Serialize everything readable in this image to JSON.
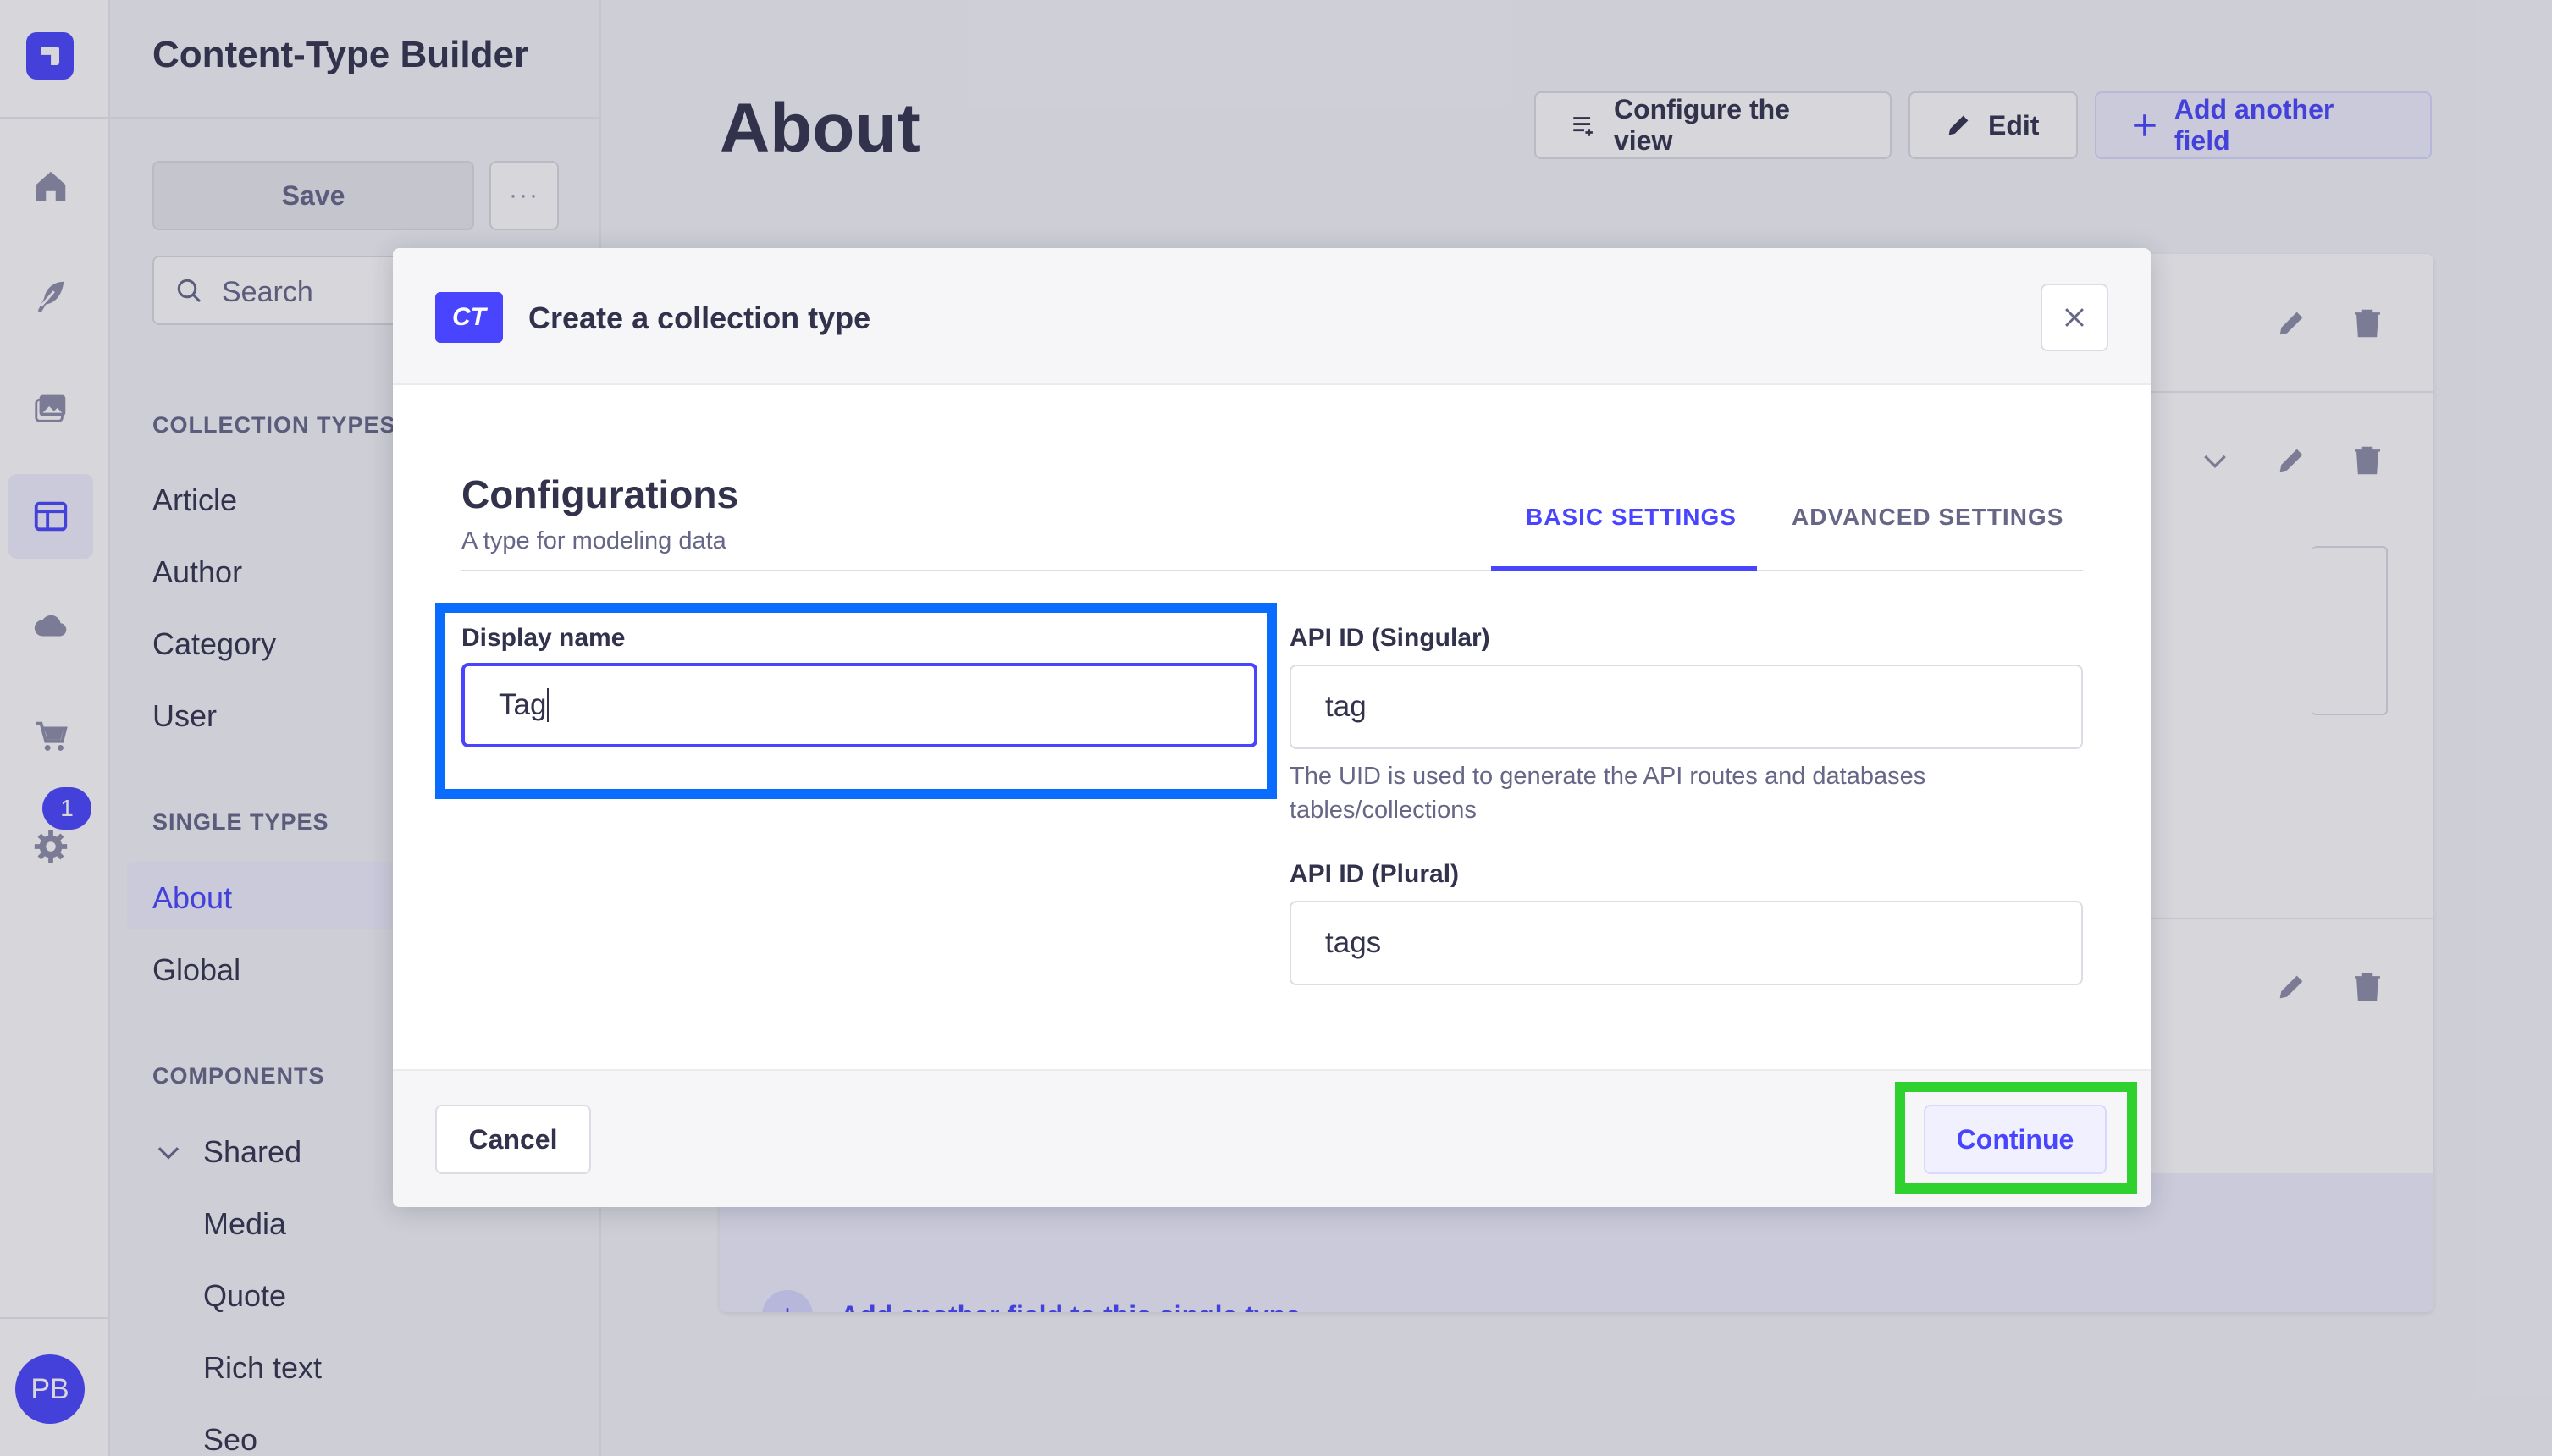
{
  "rail": {
    "items": [
      {
        "icon": "home-icon"
      },
      {
        "icon": "feather-icon"
      },
      {
        "icon": "media-library-icon"
      },
      {
        "icon": "content-type-builder-icon",
        "active": true
      },
      {
        "icon": "cloud-icon"
      },
      {
        "icon": "cart-icon"
      },
      {
        "icon": "settings-icon"
      }
    ],
    "settings_badge": "1",
    "avatar_initials": "PB"
  },
  "ctb": {
    "title": "Content-Type Builder",
    "save_label": "Save",
    "more_label": "···",
    "search_placeholder": "Search",
    "collection_types_label": "COLLECTION TYPES",
    "collection_types": [
      "Article",
      "Author",
      "Category",
      "User"
    ],
    "single_types_label": "SINGLE TYPES",
    "single_types": [
      "About",
      "Global"
    ],
    "components_label": "COMPONENTS",
    "component_group": "Shared",
    "components": [
      "Media",
      "Quote",
      "Rich text",
      "Seo"
    ]
  },
  "page": {
    "title": "About",
    "configure_view_label": "Configure the view",
    "edit_label": "Edit",
    "add_field_label": "Add another field",
    "add_field_single_label": "Add another field to this single type"
  },
  "modal": {
    "badge": "CT",
    "title": "Create a collection type",
    "section_title": "Configurations",
    "section_subtitle": "A type for modeling data",
    "tabs": [
      {
        "label": "BASIC SETTINGS",
        "active": true
      },
      {
        "label": "ADVANCED SETTINGS",
        "active": false
      }
    ],
    "display_name": {
      "label": "Display name",
      "value": "Tag"
    },
    "api_id_singular": {
      "label": "API ID (Singular)",
      "value": "tag",
      "hint": "The UID is used to generate the API routes and databases tables/collections"
    },
    "api_id_plural": {
      "label": "API ID (Plural)",
      "value": "tags"
    },
    "cancel_label": "Cancel",
    "continue_label": "Continue"
  },
  "colors": {
    "primary": "#4945ff",
    "highlight_input": "#0a6cff",
    "highlight_continue": "#2fd12f"
  }
}
